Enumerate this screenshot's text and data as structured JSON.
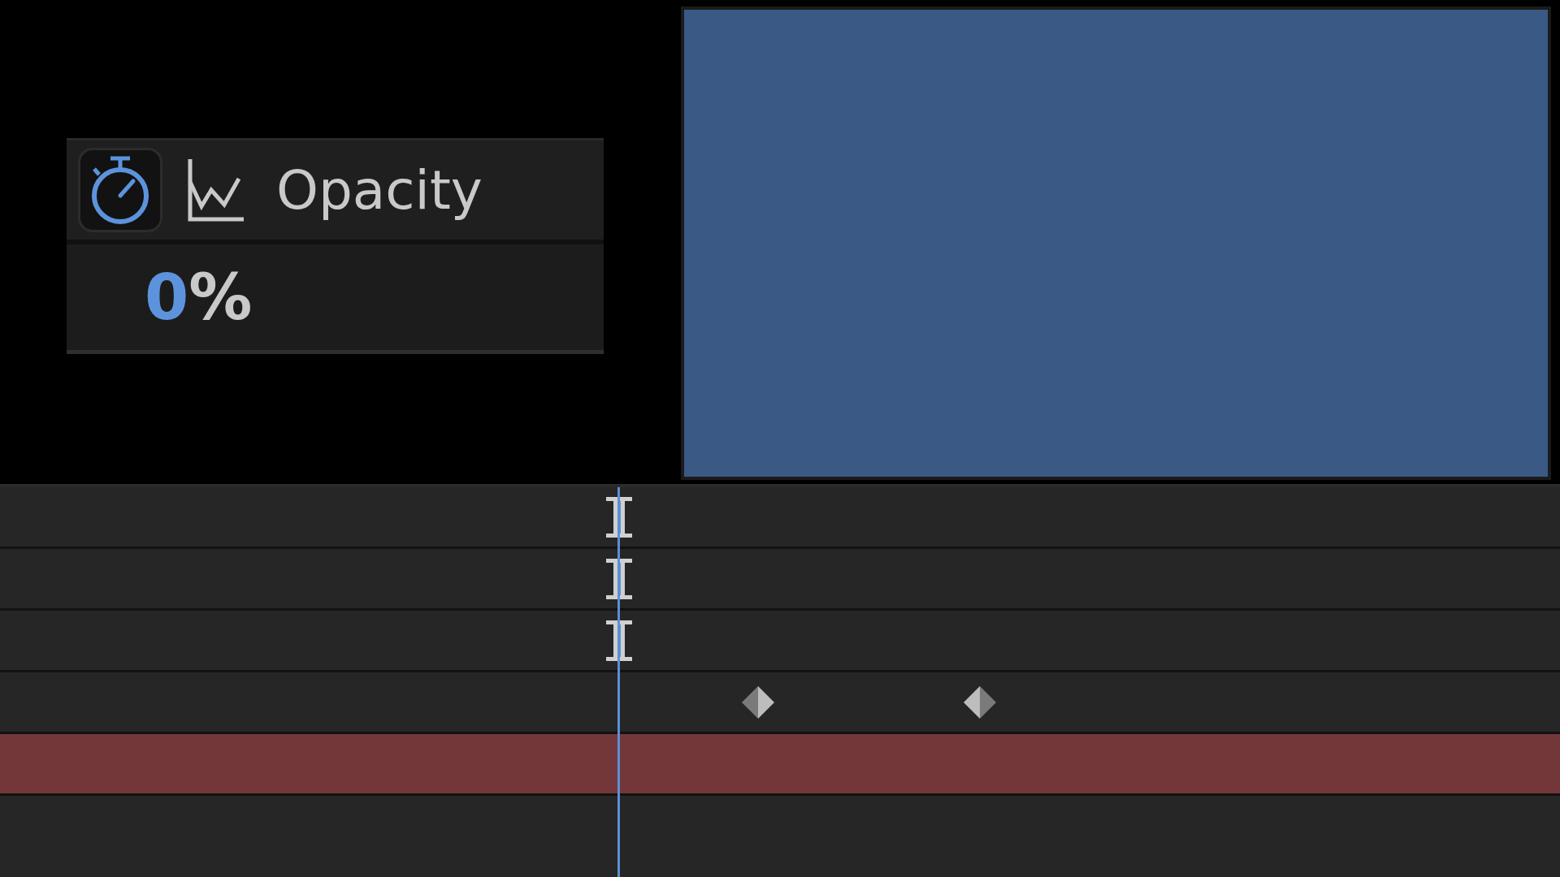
{
  "property": {
    "name": "Opacity",
    "value": "0",
    "unit": "%",
    "stopwatch_on": true
  },
  "timeline": {
    "rows": [
      {
        "kind": "marker"
      },
      {
        "kind": "marker"
      },
      {
        "kind": "marker"
      },
      {
        "kind": "keyframes",
        "keyframes": [
          {
            "kind": "diamond"
          },
          {
            "kind": "diamond"
          }
        ]
      },
      {
        "kind": "layer-bar",
        "color": "#73373a"
      },
      {
        "kind": "empty"
      }
    ]
  }
}
